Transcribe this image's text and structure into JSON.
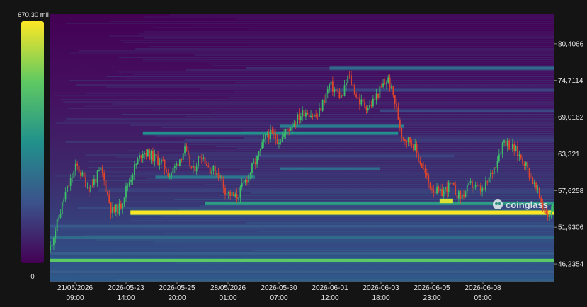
{
  "colors": {
    "background": "#141414",
    "heatmap_base": "#440154",
    "candle_up": "#3dbf6a",
    "candle_down": "#e0452b",
    "scale_stops": [
      "#440154",
      "#3b528b",
      "#21918c",
      "#5ec962",
      "#fde725"
    ]
  },
  "scale": {
    "max_label": "670,30 mil",
    "min_label": "0"
  },
  "watermark": {
    "icon": "coinglass-logo-icon",
    "text": "coinglass"
  },
  "chart_data": {
    "type": "heatmap",
    "title": "",
    "ylim": [
      43.5,
      85.0
    ],
    "y_ticks": [
      "80,4066",
      "74,7114",
      "69,0162",
      "63,321",
      "57,6258",
      "51,9306",
      "46,2354"
    ],
    "y_tick_values": [
      80.4066,
      74.7114,
      69.0162,
      63.321,
      57.6258,
      51.9306,
      46.2354
    ],
    "x_ticks": [
      {
        "date": "21/05/2026",
        "time": "09:00"
      },
      {
        "date": "2026-05-23",
        "time": "14:00"
      },
      {
        "date": "2026-05-25",
        "time": "20:00"
      },
      {
        "date": "28/05/2026",
        "time": "01:00"
      },
      {
        "date": "2026-05-30",
        "time": "07:00"
      },
      {
        "date": "2026-06-01",
        "time": "12:00"
      },
      {
        "date": "2026-06-03",
        "time": "18:00"
      },
      {
        "date": "2026-06-05",
        "time": "23:00"
      },
      {
        "date": "2026-06-08",
        "time": "05:00"
      }
    ],
    "x_range": [
      "2026-05-20T18:00",
      "2026-06-10T00:00"
    ],
    "liquidation_bands": [
      {
        "price": 54.2,
        "start": "2026-05-24T00:00",
        "end": "2026-06-10T00:00",
        "intensity": 1.0
      },
      {
        "price": 55.6,
        "start": "2026-05-27T00:00",
        "end": "2026-06-10T00:00",
        "intensity": 0.55
      },
      {
        "price": 56.0,
        "start": "2026-06-05T10:00",
        "end": "2026-06-05T23:00",
        "intensity": 0.95
      },
      {
        "price": 46.8,
        "start": "2026-05-20T18:00",
        "end": "2026-06-10T00:00",
        "intensity": 0.75
      },
      {
        "price": 47.9,
        "start": "2026-05-20T18:00",
        "end": "2026-06-10T00:00",
        "intensity": 0.3
      },
      {
        "price": 50.3,
        "start": "2026-05-20T18:00",
        "end": "2026-06-10T00:00",
        "intensity": 0.35
      },
      {
        "price": 45.0,
        "start": "2026-05-20T18:00",
        "end": "2026-06-10T00:00",
        "intensity": 0.3
      },
      {
        "price": 52.1,
        "start": "2026-05-20T18:00",
        "end": "2026-06-10T00:00",
        "intensity": 0.28
      },
      {
        "price": 59.7,
        "start": "2026-05-25T00:00",
        "end": "2026-05-29T00:00",
        "intensity": 0.4
      },
      {
        "price": 61.0,
        "start": "2026-05-30T00:00",
        "end": "2026-06-03T00:00",
        "intensity": 0.35
      },
      {
        "price": 66.5,
        "start": "2026-05-24T12:00",
        "end": "2026-06-03T18:00",
        "intensity": 0.5
      },
      {
        "price": 67.6,
        "start": "2026-05-30T00:00",
        "end": "2026-06-04T00:00",
        "intensity": 0.42
      },
      {
        "price": 76.6,
        "start": "2026-06-01T00:00",
        "end": "2026-06-10T00:00",
        "intensity": 0.35
      },
      {
        "price": 73.2,
        "start": "2026-06-01T00:00",
        "end": "2026-06-10T00:00",
        "intensity": 0.2
      },
      {
        "price": 70.0,
        "start": "2026-06-03T00:00",
        "end": "2026-06-10T00:00",
        "intensity": 0.22
      },
      {
        "price": 63.0,
        "start": "2026-05-29T00:00",
        "end": "2026-06-06T00:00",
        "intensity": 0.2
      }
    ],
    "price_path": [
      [
        "2026-05-20T18:00",
        48.3
      ],
      [
        "2026-05-21T00:00",
        51.8
      ],
      [
        "2026-05-21T09:00",
        57.0
      ],
      [
        "2026-05-21T20:00",
        61.5
      ],
      [
        "2026-05-22T08:00",
        58.0
      ],
      [
        "2026-05-22T20:00",
        60.8
      ],
      [
        "2026-05-23T06:00",
        54.3
      ],
      [
        "2026-05-23T14:00",
        55.0
      ],
      [
        "2026-05-23T20:00",
        58.0
      ],
      [
        "2026-05-24T04:00",
        61.2
      ],
      [
        "2026-05-24T12:00",
        63.8
      ],
      [
        "2026-05-24T20:00",
        63.0
      ],
      [
        "2026-05-25T06:00",
        62.0
      ],
      [
        "2026-05-25T14:00",
        60.0
      ],
      [
        "2026-05-25T20:00",
        61.5
      ],
      [
        "2026-05-26T04:00",
        64.0
      ],
      [
        "2026-05-26T12:00",
        60.5
      ],
      [
        "2026-05-26T20:00",
        63.5
      ],
      [
        "2026-05-27T04:00",
        61.0
      ],
      [
        "2026-05-27T12:00",
        60.5
      ],
      [
        "2026-05-27T20:00",
        57.5
      ],
      [
        "2026-05-28T06:00",
        56.4
      ],
      [
        "2026-05-28T16:00",
        59.5
      ],
      [
        "2026-05-29T02:00",
        62.5
      ],
      [
        "2026-05-29T12:00",
        66.5
      ],
      [
        "2026-05-30T00:00",
        65.5
      ],
      [
        "2026-05-30T12:00",
        68.0
      ],
      [
        "2026-05-31T00:00",
        70.0
      ],
      [
        "2026-05-31T12:00",
        69.0
      ],
      [
        "2026-06-01T00:00",
        74.0
      ],
      [
        "2026-06-01T12:00",
        72.0
      ],
      [
        "2026-06-01T18:00",
        75.5
      ],
      [
        "2026-06-02T04:00",
        71.5
      ],
      [
        "2026-06-02T14:00",
        70.5
      ],
      [
        "2026-06-03T00:00",
        73.0
      ],
      [
        "2026-06-03T08:00",
        75.0
      ],
      [
        "2026-06-03T14:00",
        72.0
      ],
      [
        "2026-06-03T22:00",
        66.0
      ],
      [
        "2026-06-04T08:00",
        65.0
      ],
      [
        "2026-06-04T18:00",
        61.0
      ],
      [
        "2026-06-05T00:00",
        58.5
      ],
      [
        "2026-06-05T10:00",
        57.0
      ],
      [
        "2026-06-05T20:00",
        58.5
      ],
      [
        "2026-06-06T06:00",
        56.5
      ],
      [
        "2026-06-06T16:00",
        58.5
      ],
      [
        "2026-06-07T04:00",
        57.5
      ],
      [
        "2026-06-07T14:00",
        61.0
      ],
      [
        "2026-06-08T00:00",
        65.5
      ],
      [
        "2026-06-08T10:00",
        64.0
      ],
      [
        "2026-06-08T20:00",
        62.0
      ],
      [
        "2026-06-09T04:00",
        59.0
      ],
      [
        "2026-06-09T14:00",
        55.0
      ],
      [
        "2026-06-09T20:00",
        53.5
      ],
      [
        "2026-06-10T00:00",
        56.5
      ]
    ]
  }
}
